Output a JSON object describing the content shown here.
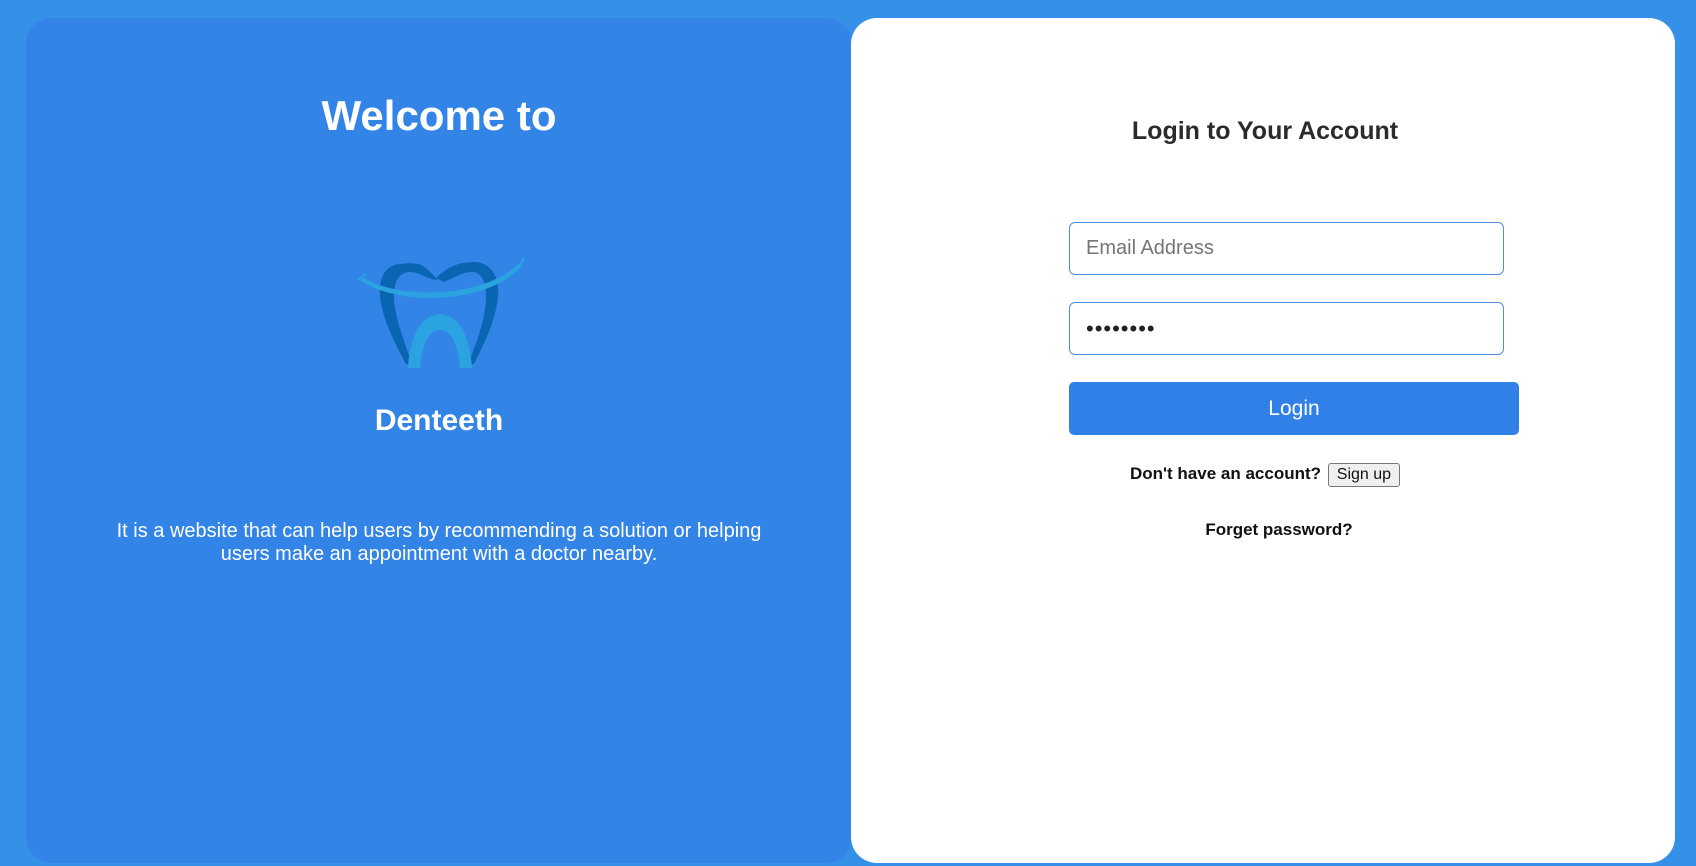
{
  "left_panel": {
    "welcome": "Welcome to",
    "logo_icon": "tooth-smile-logo",
    "brand": "Denteeth",
    "description": "It is a website that can help users by recommending a solution or helping users make an appointment with a doctor nearby."
  },
  "login": {
    "title": "Login to Your Account",
    "email_placeholder": "Email Address",
    "email_value": "",
    "password_value": "••••••••",
    "login_label": "Login",
    "signup_prompt": "Don't have an account?",
    "signup_label": "Sign up",
    "forget_label": "Forget password?"
  },
  "colors": {
    "page_background": "#3590e8",
    "left_panel": "#3384e7",
    "login_button": "#3080e8",
    "input_border": "#4a90e2",
    "logo_dark": "#0a66b3",
    "logo_light": "#2aa3e0"
  }
}
